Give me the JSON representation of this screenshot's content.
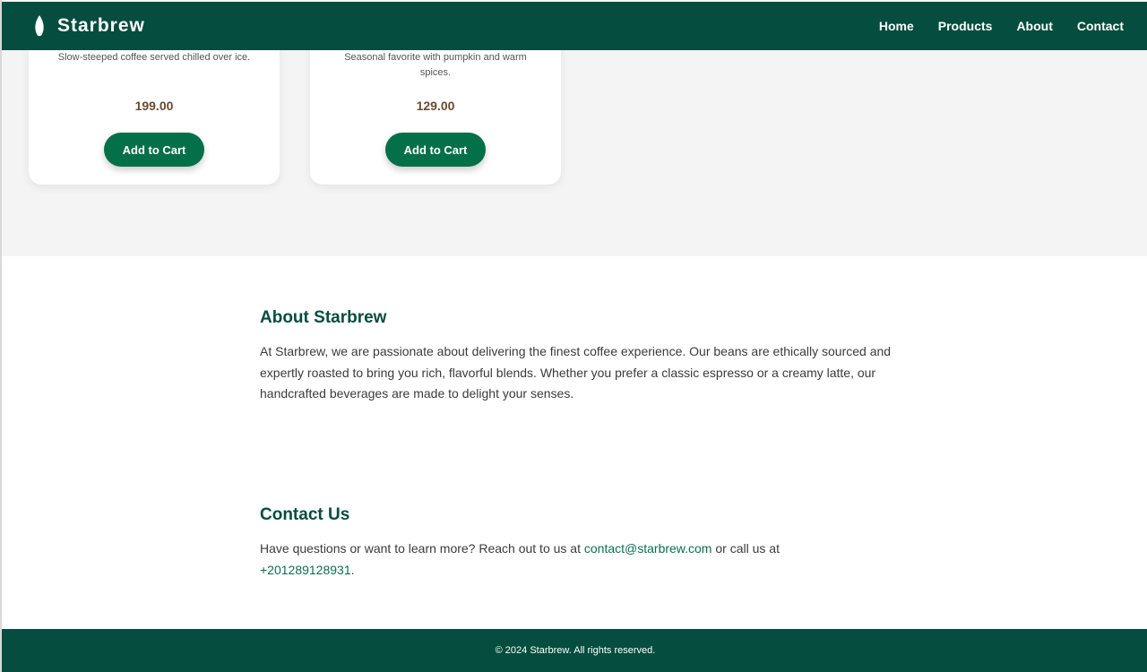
{
  "header": {
    "brand": "Starbrew",
    "nav": [
      "Home",
      "Products",
      "About",
      "Contact"
    ]
  },
  "products": [
    {
      "description": "Slow-steeped coffee served chilled over ice.",
      "price": "199.00",
      "button": "Add to Cart"
    },
    {
      "description": "Seasonal favorite with pumpkin and warm spices.",
      "price": "129.00",
      "button": "Add to Cart"
    }
  ],
  "about": {
    "title": "About Starbrew",
    "text": "At Starbrew, we are passionate about delivering the finest coffee experience. Our beans are ethically sourced and expertly roasted to bring you rich, flavorful blends. Whether you prefer a classic espresso or a creamy latte, our handcrafted beverages are made to delight your senses."
  },
  "contact": {
    "title": "Contact Us",
    "text_before": "Have questions or want to learn more? Reach out to us at ",
    "email": "contact@starbrew.com",
    "text_middle": " or call us at ",
    "phone": "+201289128931",
    "text_after": "."
  },
  "footer": {
    "text": "© 2024 Starbrew. All rights reserved."
  },
  "colors": {
    "primary": "#054d3e",
    "button": "#04704a",
    "price": "#6b4a32",
    "link": "#0b6e4f"
  }
}
